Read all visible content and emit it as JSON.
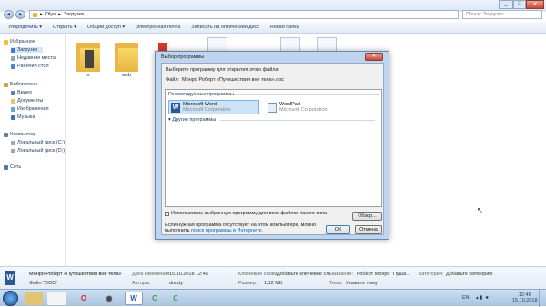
{
  "breadcrumb": [
    "Olya",
    "Загрузки"
  ],
  "search_placeholder": "Поиск: Загрузки",
  "toolbar": [
    "Упорядочить ▾",
    "Открыть ▾",
    "Общий доступ ▾",
    "Электронная почта",
    "Записать на оптический диск",
    "Новая папка"
  ],
  "sidebar": {
    "favorites": "Избранное",
    "fav_items": [
      "Загрузки",
      "Недавние места",
      "Рабочий стол"
    ],
    "libraries": "Библиотеки",
    "lib_items": [
      "Видео",
      "Документы",
      "Изображения",
      "Музыка"
    ],
    "computer": "Компьютер",
    "comp_items": [
      "Локальный диск (C:)",
      "Локальный диск (D:)"
    ],
    "network": "Сеть"
  },
  "folders": [
    "п",
    "web"
  ],
  "dialog": {
    "title": "Выбор программы",
    "instruction": "Выберите программу для открытия этого файла:",
    "file_label": "Файл:",
    "file_name": "Монро Роберт «Путешествия вне тела».doc",
    "recommended": "Рекомендуемые программы",
    "other": "Другие программы",
    "programs": [
      {
        "name": "Microsoft Word",
        "vendor": "Microsoft Corporation"
      },
      {
        "name": "WordPad",
        "vendor": "Microsoft Corporation"
      }
    ],
    "checkbox": "Использовать выбранную программу для всех файлов такого типа",
    "browse": "Обзор...",
    "hint": "Если нужная программа отсутствует на этом компьютере, можно выполнить",
    "hint_link": "поиск программы в Интернете.",
    "ok": "ОК",
    "cancel": "Отмена"
  },
  "details": {
    "file_title": "Монро Роберт «Путешествия вне тела»",
    "file_type": "Файл \"DOC\"",
    "modified_label": "Дата изменения:",
    "modified": "15.10.2018 12:45",
    "author_label": "Авторы:",
    "author": "doddy",
    "keywords_label": "Ключевые слова:",
    "keywords": "Добавьте ключевое сл...",
    "size_label": "Размер:",
    "size": "1,12 МБ",
    "name_label": "Название:",
    "name": "Роберт Монро \"Пуша...",
    "subject_label": "Тема:",
    "subject": "Укажите тему",
    "category_label": "Категории:",
    "category": "Добавьте категорию"
  },
  "taskbar": {
    "lang": "EN",
    "time": "12:46",
    "date": "15.10.2018"
  }
}
